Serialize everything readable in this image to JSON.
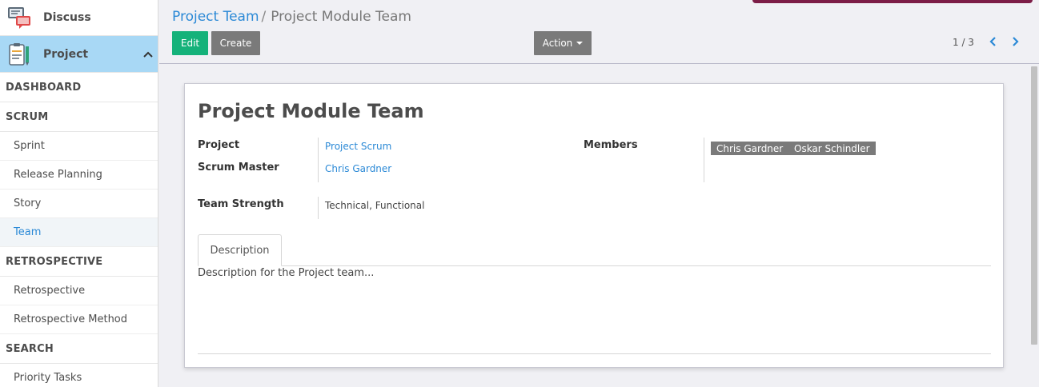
{
  "sidebar": {
    "apps": [
      {
        "label": "Discuss",
        "icon": "discuss-chat-icon"
      },
      {
        "label": "Project",
        "icon": "project-clipboard-icon"
      }
    ],
    "sections": {
      "dashboard": "DASHBOARD",
      "scrum": "SCRUM",
      "retrospective": "RETROSPECTIVE",
      "search": "SEARCH"
    },
    "items": {
      "sprint": "Sprint",
      "release_planning": "Release Planning",
      "story": "Story",
      "team": "Team",
      "retrospective": "Retrospective",
      "retrospective_method": "Retrospective Method",
      "priority_tasks": "Priority Tasks"
    }
  },
  "header": {
    "breadcrumb_parent": "Project Team",
    "breadcrumb_separator": "/",
    "breadcrumb_current": "Project Module Team",
    "edit_label": "Edit",
    "create_label": "Create",
    "action_label": "Action",
    "pager": "1 / 3"
  },
  "form": {
    "title": "Project Module Team",
    "project_label": "Project",
    "project_value": "Project Scrum",
    "scrum_master_label": "Scrum Master",
    "scrum_master_value": "Chris Gardner",
    "members_label": "Members",
    "members": [
      "Chris Gardner",
      "Oskar Schindler"
    ],
    "team_strength_label": "Team Strength",
    "team_strength_value": "Technical, Functional",
    "tab_label": "Description",
    "description": "Description for the Project team..."
  },
  "colors": {
    "primary_link": "#2b89d6",
    "edit_button": "#15b27a",
    "secondary_button": "#7a7a7a",
    "active_app": "#a8d8f5",
    "top_accent": "#7c1d47"
  }
}
